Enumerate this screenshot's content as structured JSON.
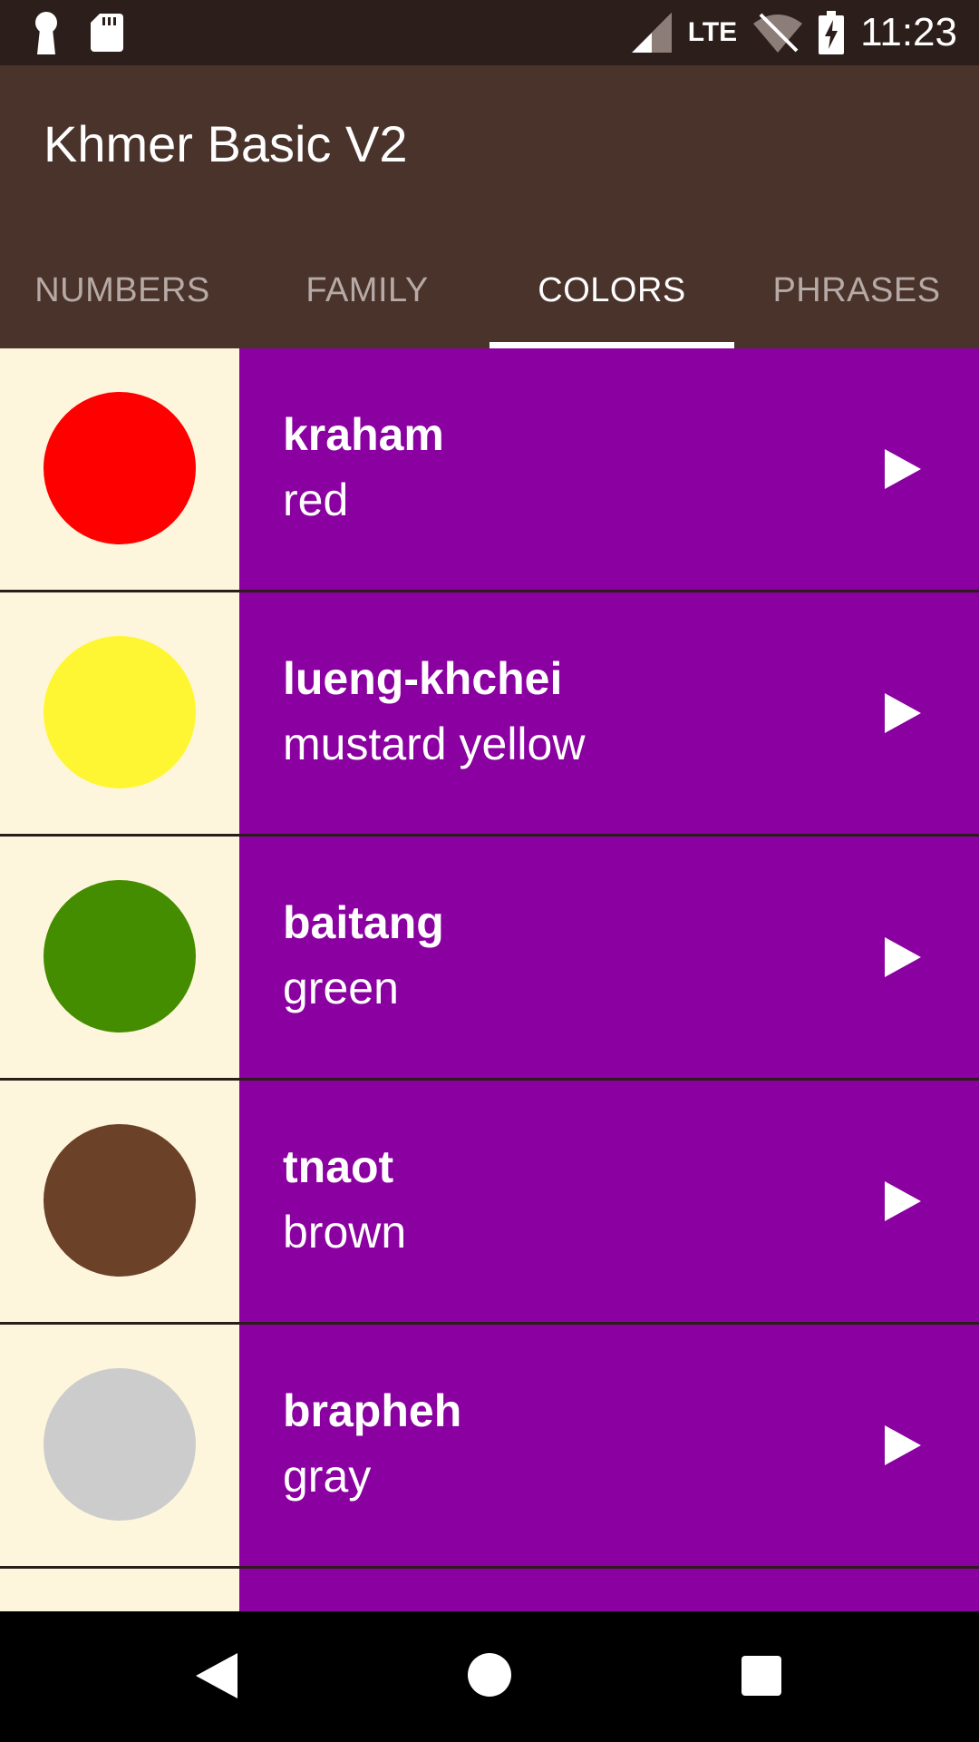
{
  "status_bar": {
    "time": "11:23",
    "network": "LTE",
    "icons": [
      "keyhole-icon",
      "sd-card-icon",
      "signal-icon",
      "wifi-off-icon",
      "battery-charging-icon"
    ]
  },
  "app": {
    "title": "Khmer Basic V2",
    "colors": {
      "app_bar": "#4a332b",
      "status_bar": "#2c1e1a",
      "list_bg": "#8a00a0",
      "swatch_bg": "#fef6dc"
    }
  },
  "tabs": [
    {
      "label": "NUMBERS",
      "active": false
    },
    {
      "label": "FAMILY",
      "active": false
    },
    {
      "label": "COLORS",
      "active": true
    },
    {
      "label": "PHRASES",
      "active": false
    }
  ],
  "items": [
    {
      "khmer": "kraham",
      "english": "red",
      "color": "#ff0000"
    },
    {
      "khmer": "lueng-khchei",
      "english": "mustard yellow",
      "color": "#fff633"
    },
    {
      "khmer": "baitang",
      "english": "green",
      "color": "#448d00"
    },
    {
      "khmer": "tnaot",
      "english": "brown",
      "color": "#6b4128"
    },
    {
      "khmer": "brapheh",
      "english": "gray",
      "color": "#cccccc"
    },
    {
      "khmer": "",
      "english": "",
      "color": "#000000"
    }
  ],
  "nav": [
    "back-icon",
    "home-icon",
    "recents-icon"
  ]
}
